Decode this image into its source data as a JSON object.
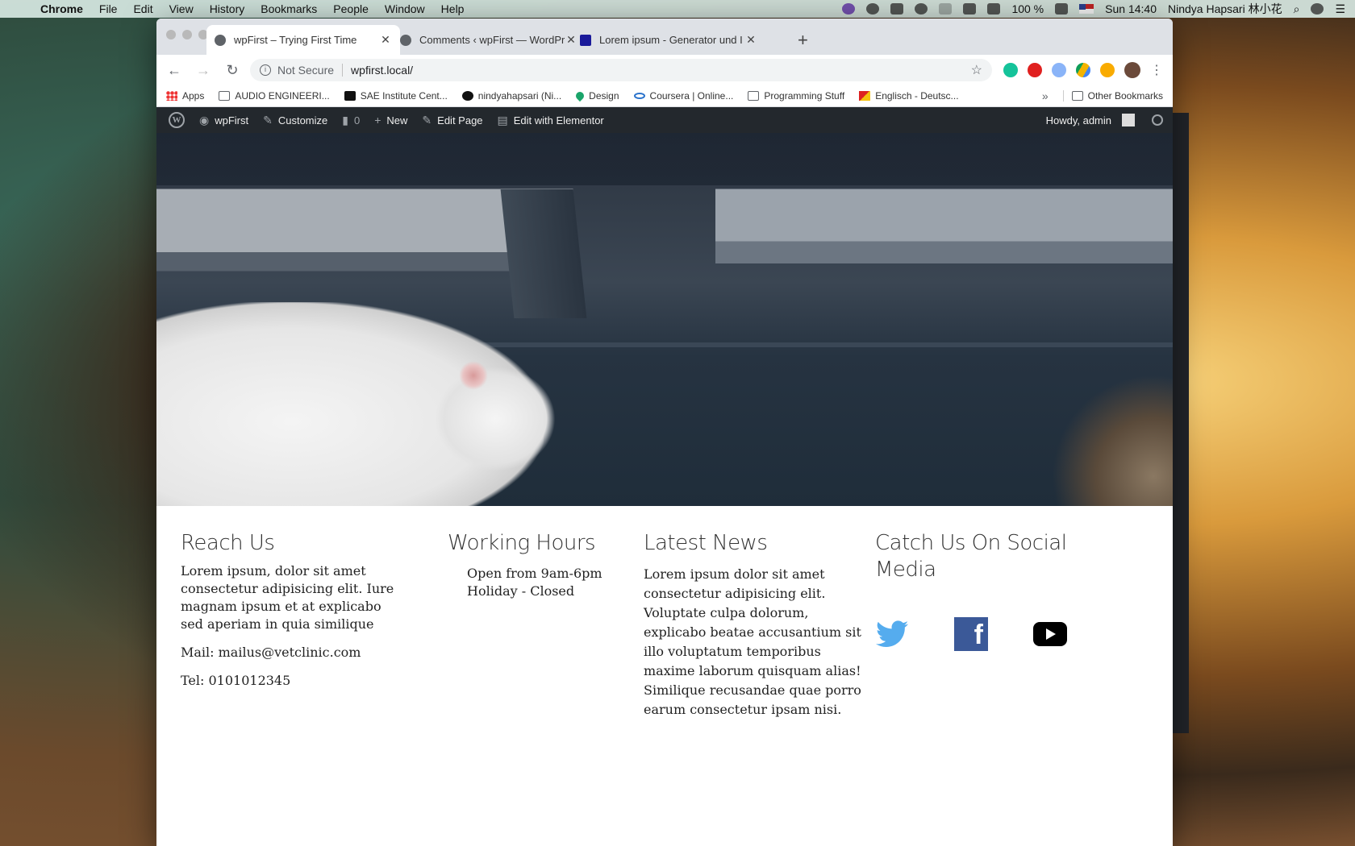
{
  "menubar": {
    "app": "Chrome",
    "items": [
      "File",
      "Edit",
      "View",
      "History",
      "Bookmarks",
      "People",
      "Window",
      "Help"
    ],
    "battery": "100 %",
    "clock": "Sun 14:40",
    "user": "Nindya Hapsari 林小花"
  },
  "tabs": [
    {
      "title": "wpFirst – Trying First Time"
    },
    {
      "title": "Comments ‹ wpFirst — WordPr"
    },
    {
      "title": "Lorem ipsum - Generator und I"
    }
  ],
  "omnibox": {
    "security": "Not Secure",
    "url": "wpfirst.local/"
  },
  "bookmarks": [
    {
      "label": "Apps"
    },
    {
      "label": "AUDIO ENGINEERI..."
    },
    {
      "label": "SAE Institute Cent..."
    },
    {
      "label": "nindyahapsari (Ni..."
    },
    {
      "label": "Design"
    },
    {
      "label": "Coursera | Online..."
    },
    {
      "label": "Programming Stuff"
    },
    {
      "label": "Englisch - Deutsc..."
    }
  ],
  "bookmarks_more": "»",
  "bookmarks_other": "Other Bookmarks",
  "wpbar": {
    "site": "wpFirst",
    "customize": "Customize",
    "comments_count": "0",
    "new": "New",
    "edit_page": "Edit Page",
    "elementor": "Edit with Elementor",
    "howdy": "Howdy, admin"
  },
  "widgets": {
    "reach": {
      "title": "Reach Us",
      "body": "Lorem ipsum, dolor sit amet consectetur adipisicing elit. Iure magnam ipsum et at explicabo sed aperiam in quia similique",
      "mail": "Mail: mailus@vetclinic.com",
      "tel": "Tel: 0101012345"
    },
    "hours": {
      "title": "Working Hours",
      "line1": "Open from 9am-6pm",
      "line2": "Holiday - Closed"
    },
    "news": {
      "title": "Latest News",
      "body": "Lorem ipsum dolor sit amet consectetur adipisicing elit. Voluptate culpa dolorum, explicabo beatae accusantium sit illo voluptatum temporibus maxime laborum quisquam alias! Similique recusandae quae porro earum consectetur ipsam nisi."
    },
    "social": {
      "title": "Catch Us On Social Media",
      "icons": [
        "twitter-icon",
        "facebook-icon",
        "youtube-icon"
      ]
    }
  },
  "colors": {
    "wpbar": "#23282d",
    "twitter": "#55acee",
    "facebook": "#3b5998",
    "youtube": "#000000"
  }
}
